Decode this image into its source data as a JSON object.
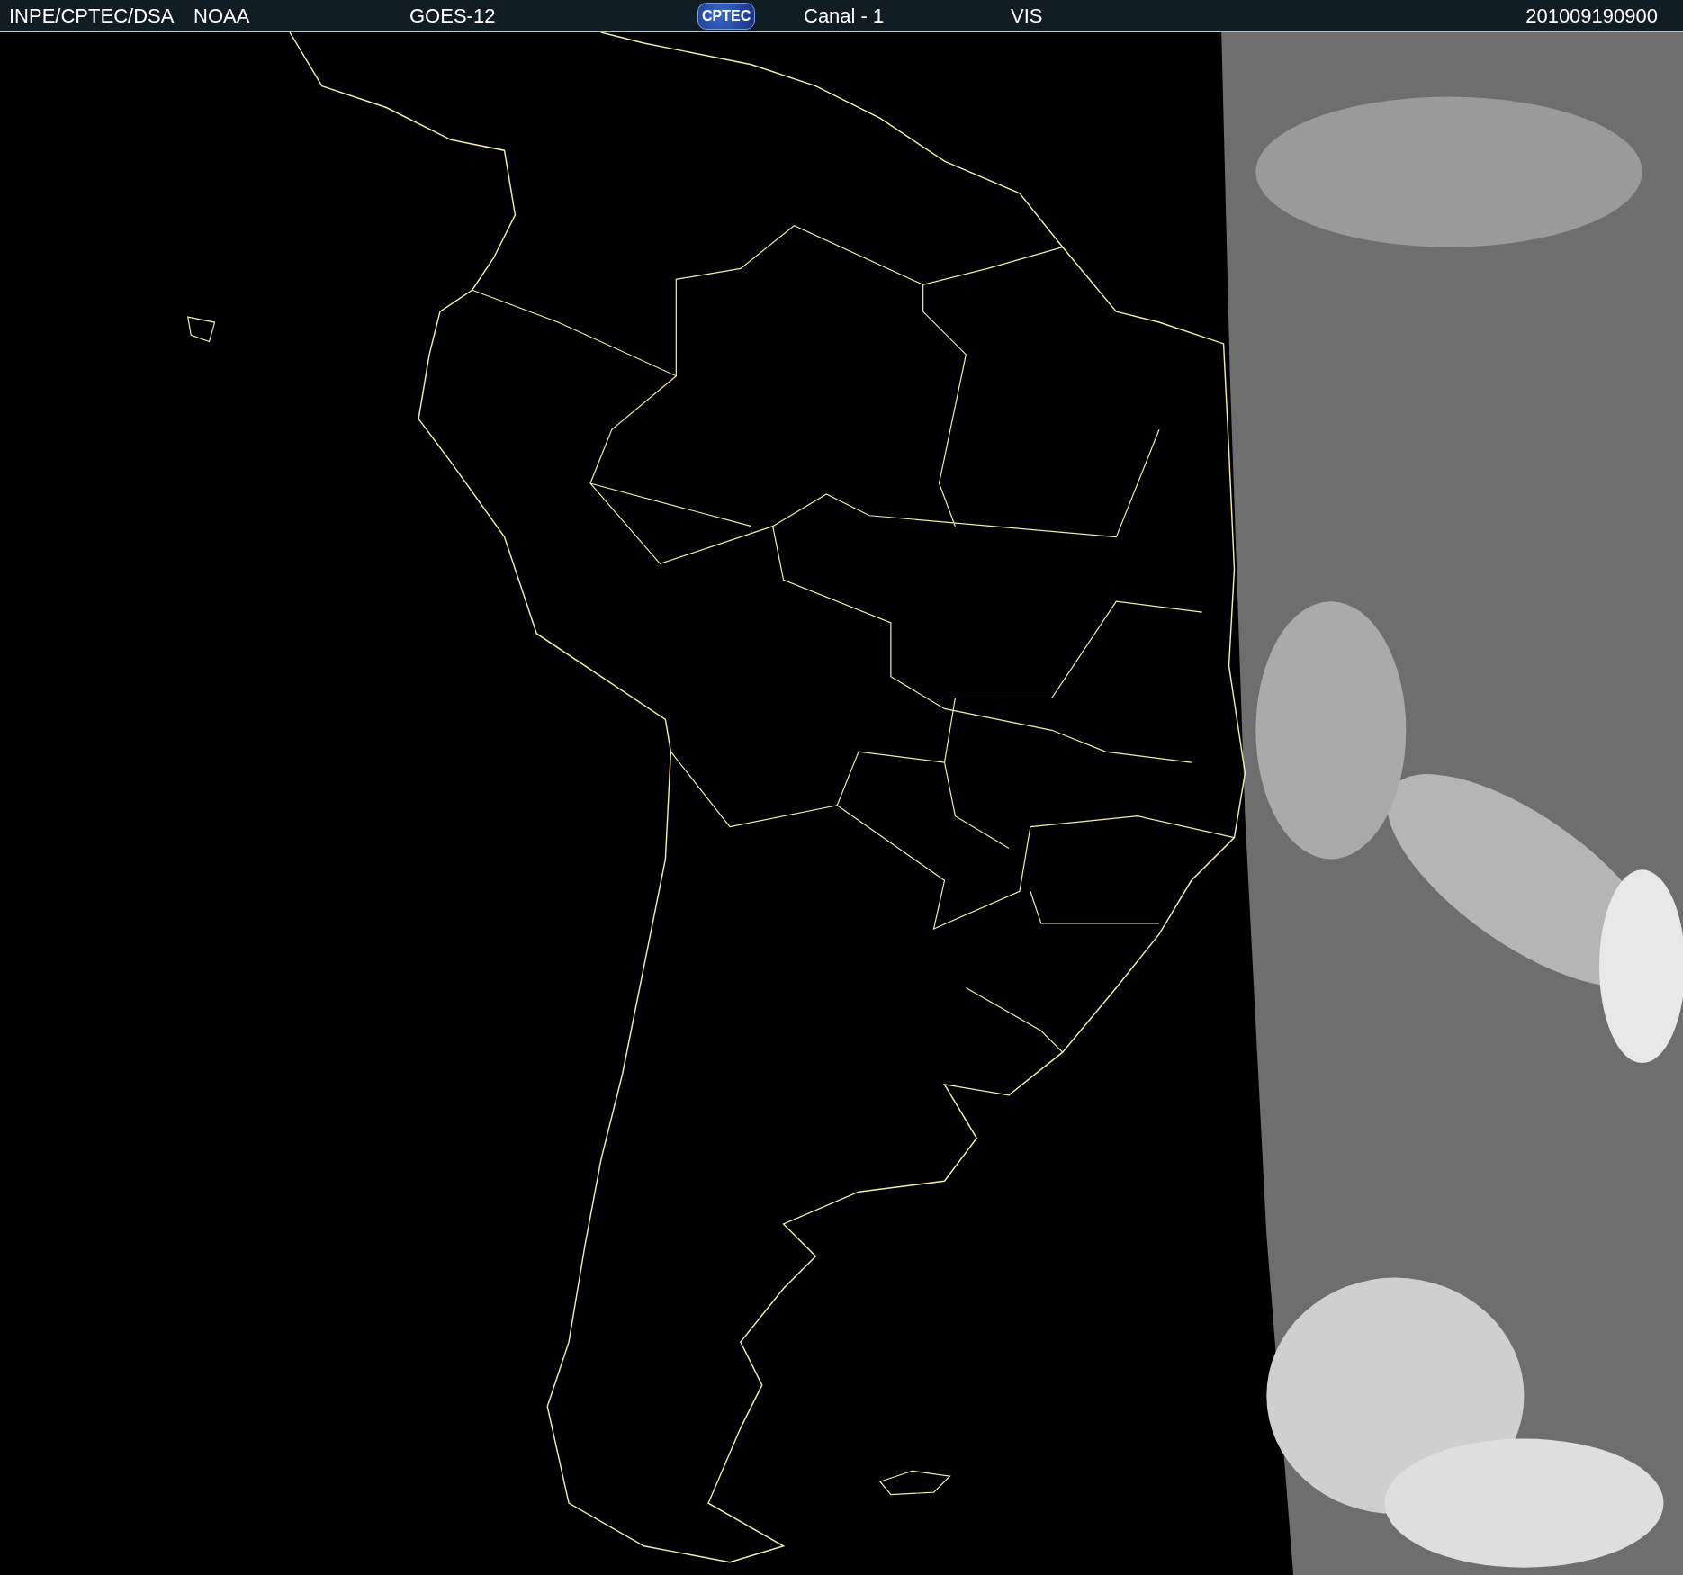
{
  "header": {
    "items": [
      {
        "kind": "text",
        "text": "INPE/CPTEC/DSA"
      },
      {
        "kind": "text",
        "text": "NOAA"
      },
      {
        "kind": "text",
        "text": "GOES-12"
      },
      {
        "kind": "logo",
        "text": "CPTEC"
      },
      {
        "kind": "text",
        "text": "Canal - 1"
      },
      {
        "kind": "text",
        "text": "VIS"
      },
      {
        "kind": "text",
        "text": "201009190900"
      }
    ]
  }
}
